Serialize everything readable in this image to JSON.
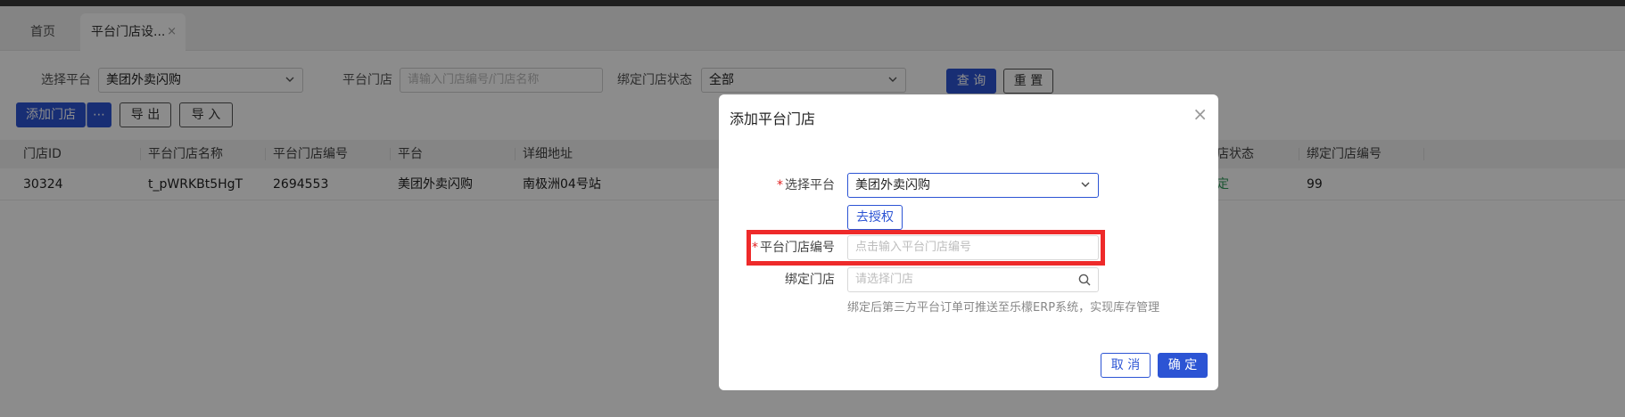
{
  "tabs": {
    "home": "首页",
    "active": "平台门店设...",
    "close_glyph": "×"
  },
  "filters": {
    "platform_label": "选择平台",
    "platform_value": "美团外卖闪购",
    "store_label": "平台门店",
    "store_placeholder": "请输入门店编号/门店名称",
    "bind_label": "绑定门店状态",
    "bind_value": "全部",
    "query": "查 询",
    "reset": "重 置"
  },
  "toolbar": {
    "add_store": "添加门店",
    "more": "⋯",
    "export": "导 出",
    "import": "导 入"
  },
  "table": {
    "columns": [
      "门店ID",
      "平台门店名称",
      "平台门店编号",
      "平台",
      "详细地址",
      "店状态",
      "绑定门店编号"
    ],
    "rows": [
      {
        "id": "30324",
        "name": "t_pWRKBt5HgT",
        "code": "2694553",
        "platform": "美团外卖闪购",
        "address": "南极洲04号站",
        "status": "定",
        "bind_code": "99"
      }
    ]
  },
  "modal": {
    "title": "添加平台门店",
    "close_glyph": "×",
    "required_mark": "*",
    "platform_label": "选择平台",
    "platform_value": "美团外卖闪购",
    "authorize": "去授权",
    "store_code_label": "平台门店编号",
    "store_code_placeholder": "点击输入平台门店编号",
    "bind_store_label": "绑定门店",
    "bind_store_placeholder": "请选择门店",
    "hint": "绑定后第三方平台订单可推送至乐檬ERP系统，实现库存管理",
    "cancel": "取 消",
    "confirm": "确 定"
  },
  "colors": {
    "primary": "#2c54d4",
    "highlight": "#ee2a2a",
    "status_green": "#2e9a5a"
  }
}
